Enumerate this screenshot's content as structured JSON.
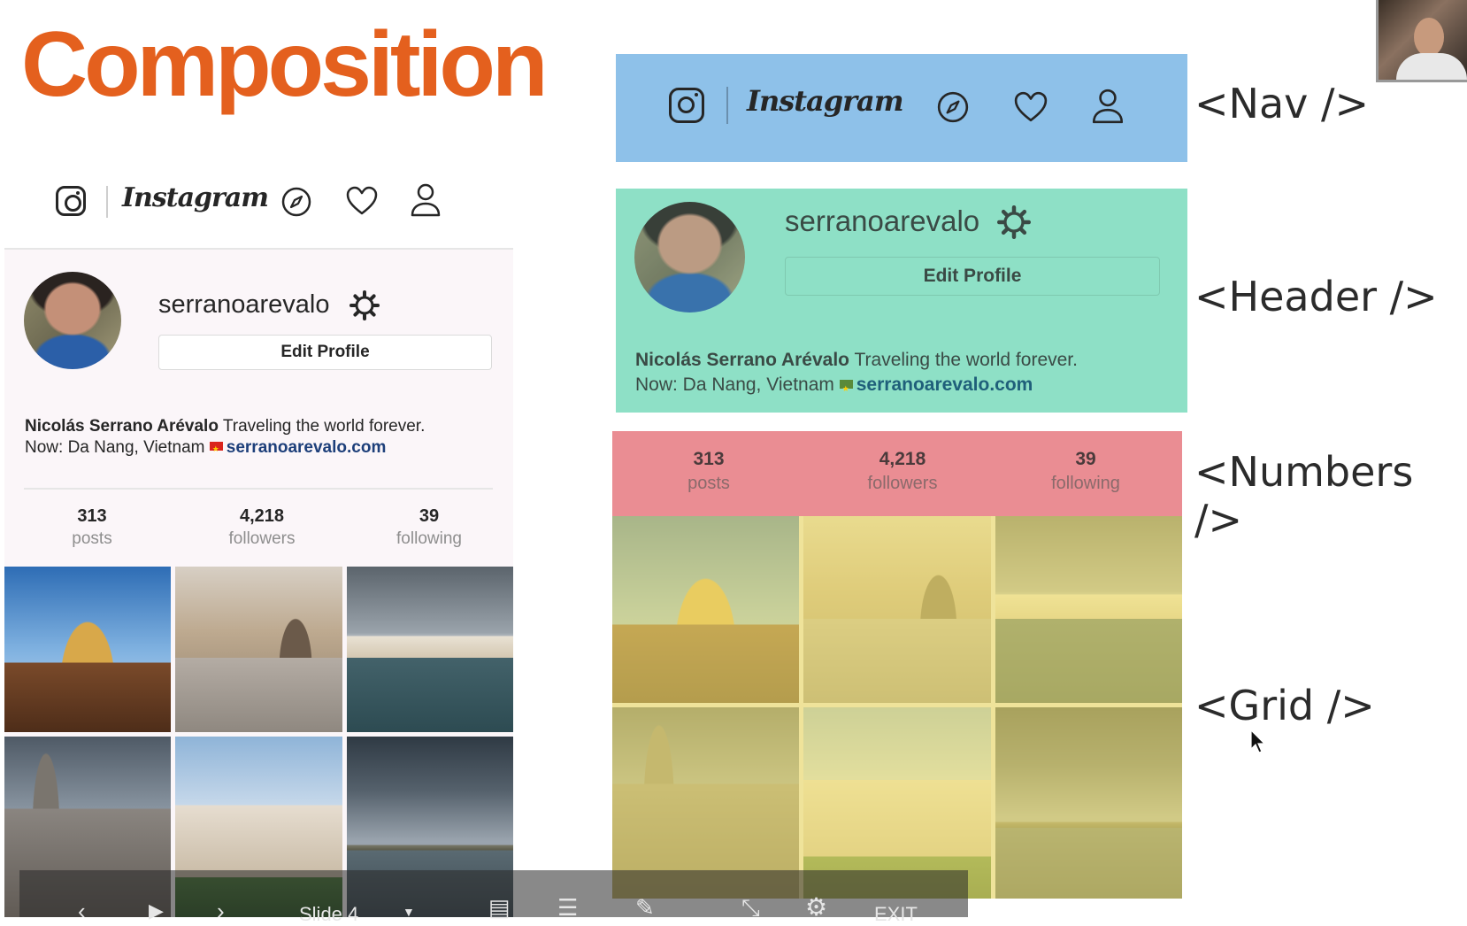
{
  "slide_title": "Composition",
  "nav": {
    "wordmark": "Instagram"
  },
  "profile": {
    "username": "serranoarevalo",
    "edit_button": "Edit Profile",
    "full_name": "Nicolás Serrano Arévalo",
    "bio_line1": "Traveling the world forever.",
    "bio_line2": "Now: Da Nang, Vietnam",
    "website": "serranoarevalo.com"
  },
  "stats": [
    {
      "num": "313",
      "label": "posts"
    },
    {
      "num": "4,218",
      "label": "followers"
    },
    {
      "num": "39",
      "label": "following"
    }
  ],
  "component_labels": {
    "nav": "<Nav />",
    "header": "<Header />",
    "numbers": "<Numbers />",
    "grid": "<Grid />"
  },
  "toolbar": {
    "slide_label": "Slide 4",
    "exit_label": "EXIT"
  },
  "colors": {
    "title": "#e4601e",
    "nav_block": "#8ec1e9",
    "header_block": "#8ee0c6",
    "numbers_block": "#ea8d93",
    "grid_block": "#efe39a",
    "link": "#1d3f7a"
  },
  "icons": [
    "instagram-logo-icon",
    "compass-icon",
    "heart-icon",
    "user-icon",
    "gear-icon",
    "vietnam-flag-icon",
    "mouse-cursor-icon"
  ]
}
